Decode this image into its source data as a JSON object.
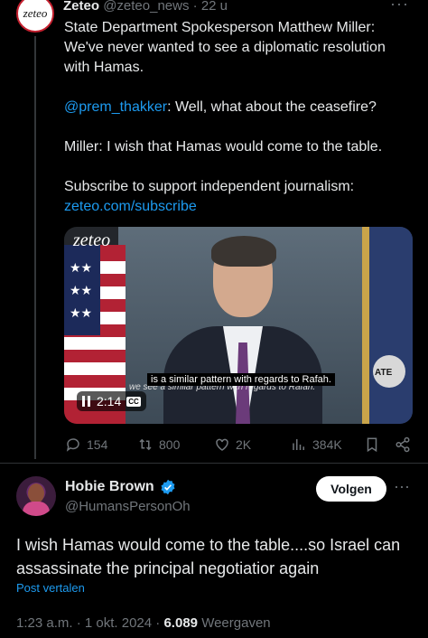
{
  "top_tweet": {
    "avatar_text": "zeteo",
    "name": "Zeteo",
    "handle": "@zeteo_news",
    "separator": "·",
    "time": "22 u",
    "more": "···",
    "paragraphs": {
      "p1": "State Department Spokesperson Matthew Miller: We've never wanted to see a diplomatic resolution with Hamas.",
      "p2_mention": "@prem_thakker",
      "p2_rest": ": Well, what about the ceasefire?",
      "p3": "Miller: I wish that Hamas would come to the table.",
      "p4": "Subscribe to support independent journalism:",
      "p4_link": "zeteo.com/subscribe"
    },
    "video": {
      "logo": "zeteo",
      "caption": "is a similar pattern with regards to Rafah.",
      "caption_under": "we see a similar pattern with regards to Rafah.",
      "time": "2:14",
      "cc": "CC"
    },
    "actions": {
      "replies": "154",
      "reposts": "800",
      "likes": "2K",
      "views": "384K"
    }
  },
  "reply": {
    "name": "Hobie Brown",
    "handle": "@HumansPersonOh",
    "follow": "Volgen",
    "more": "···",
    "text": "I wish Hamas would come to the table....so Israel can assassinate the principal negotiatior again",
    "translate": "Post vertalen",
    "meta": {
      "time": "1:23 a.m.",
      "sep1": "·",
      "date": "1 okt. 2024",
      "sep2": "·",
      "views_num": "6.089",
      "views_label": "Weergaven"
    }
  },
  "colors": {
    "background": "#000000",
    "text": "#e7e9ea",
    "muted": "#71767b",
    "link": "#1d9bf0",
    "verified": "#1d9bf0"
  }
}
